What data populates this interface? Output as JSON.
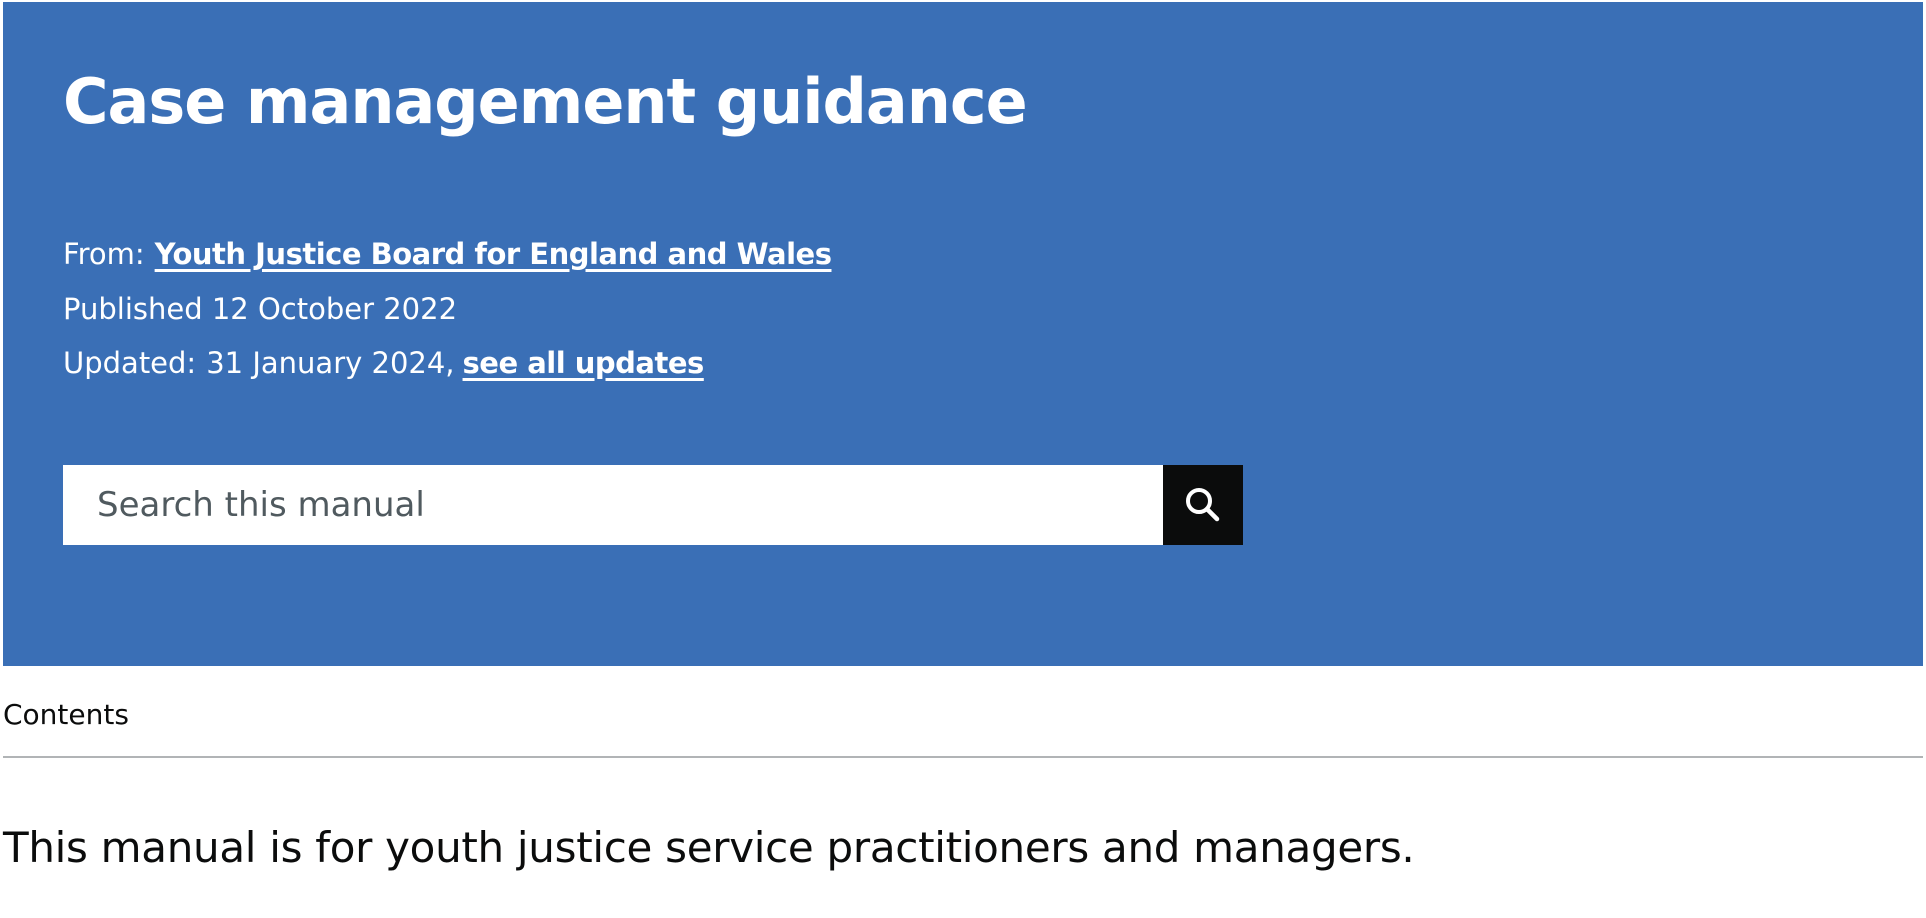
{
  "header": {
    "title": "Case management guidance",
    "from_label": "From:",
    "organisation": "Youth Justice Board for England and Wales",
    "published_text": "Published 12 October 2022",
    "updated_label": "Updated:",
    "updated_date": "31 January 2024,",
    "see_all_updates": "see all updates"
  },
  "search": {
    "placeholder": "Search this manual",
    "button_icon": "search-icon"
  },
  "contents": {
    "label": "Contents"
  },
  "body": {
    "intro": "This manual is for youth justice service practitioners and managers."
  },
  "colors": {
    "hero_background": "#3a6fb6",
    "search_button": "#0b0c0c",
    "divider": "#b1b4b6"
  }
}
